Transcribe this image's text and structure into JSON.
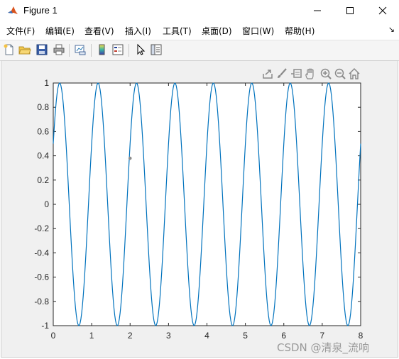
{
  "window": {
    "title": "Figure 1",
    "icon": "matlab-logo-icon",
    "controls": [
      "minimize-icon",
      "maximize-icon",
      "close-icon"
    ]
  },
  "menu": {
    "items": [
      {
        "label": "文件(F)"
      },
      {
        "label": "编辑(E)"
      },
      {
        "label": "查看(V)"
      },
      {
        "label": "插入(I)"
      },
      {
        "label": "工具(T)"
      },
      {
        "label": "桌面(D)"
      },
      {
        "label": "窗口(W)"
      },
      {
        "label": "帮助(H)"
      }
    ],
    "overflow_icon": "menu-arrow-icon"
  },
  "toolbar": {
    "buttons": [
      "new-figure-icon",
      "open-file-icon",
      "save-icon",
      "print-icon",
      "link-plot-icon",
      "colorbar-icon",
      "legend-icon",
      "edit-plot-icon",
      "property-inspector-icon"
    ]
  },
  "axes_toolbar": {
    "buttons": [
      "export-icon",
      "brush-icon",
      "data-tips-icon",
      "pan-icon",
      "zoom-in-icon",
      "zoom-out-icon",
      "restore-view-icon"
    ]
  },
  "colors": {
    "line": "#0072BD",
    "marker": "#8c8c8c",
    "figure_bg": "#f0f0f0"
  },
  "chart_data": {
    "type": "line",
    "title": "",
    "xlabel": "",
    "ylabel": "",
    "xlim": [
      0,
      8
    ],
    "ylim": [
      -1,
      1
    ],
    "grid": false,
    "xticks": [
      0,
      1,
      2,
      3,
      4,
      5,
      6,
      7,
      8
    ],
    "xtick_labels": [
      "0",
      "1",
      "2",
      "3",
      "4",
      "5",
      "6",
      "7",
      "8"
    ],
    "yticks": [
      1,
      0.8,
      0.6,
      0.4,
      0.2,
      0,
      -0.2,
      -0.4,
      -0.6,
      -0.8,
      -1
    ],
    "ytick_labels": [
      "1",
      "0.8",
      "0.6",
      "0.4",
      "0.2",
      "0",
      "-0.2",
      "-0.4",
      "-0.6",
      "-0.8",
      "-1"
    ],
    "series": [
      {
        "function": "sin(2*pi*t + pi/6)",
        "frequency": 1,
        "phase": 0.5236,
        "amplitude": 1,
        "x_range": [
          0,
          8
        ],
        "samples": 400
      }
    ],
    "marker_point": {
      "x": 2,
      "y": 0.38
    }
  },
  "watermark": "CSDN @清泉_流响"
}
